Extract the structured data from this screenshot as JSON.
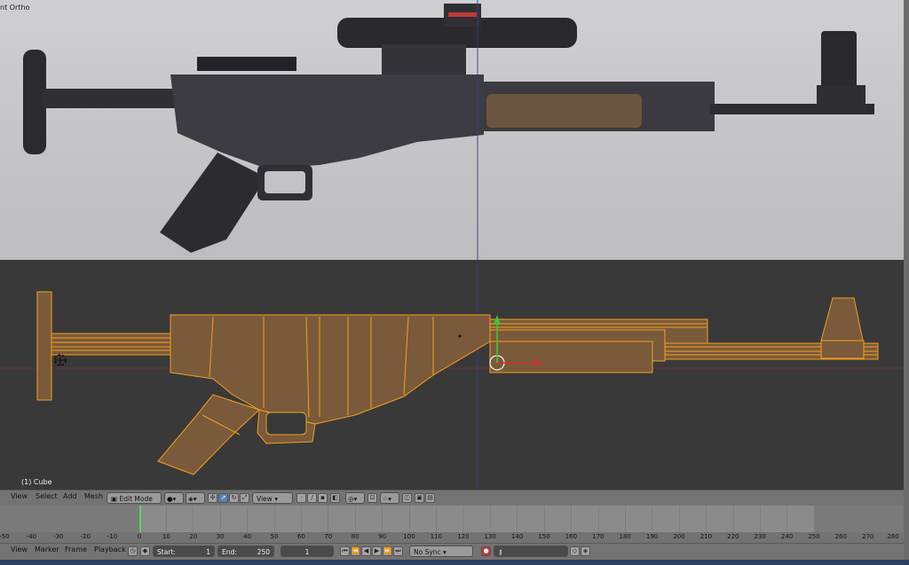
{
  "viewport": {
    "label": "nt Ortho",
    "object_label": "(1) Cube"
  },
  "header": {
    "view": "View",
    "select": "Select",
    "add": "Add",
    "mesh": "Mesh",
    "mode": "Edit Mode",
    "orientation": "View"
  },
  "ruler": {
    "ticks": [
      "-50",
      "-40",
      "-30",
      "-20",
      "-10",
      "0",
      "10",
      "20",
      "30",
      "40",
      "50",
      "60",
      "70",
      "80",
      "90",
      "100",
      "110",
      "120",
      "130",
      "140",
      "150",
      "160",
      "170",
      "180",
      "190",
      "200",
      "210",
      "220",
      "230",
      "240",
      "250",
      "260",
      "270",
      "280"
    ]
  },
  "footer": {
    "view": "View",
    "marker": "Marker",
    "frame": "Frame",
    "playback": "Playback",
    "start_label": "Start:",
    "start_value": "1",
    "end_label": "End:",
    "end_value": "250",
    "current_frame": "1",
    "sync": "No Sync"
  },
  "colors": {
    "mesh_fill": "#7a5a3a",
    "mesh_edge": "#f0a020",
    "axis_x": "#c83232",
    "axis_y": "#3cc83c",
    "frame_cursor": "#5fd35f"
  }
}
